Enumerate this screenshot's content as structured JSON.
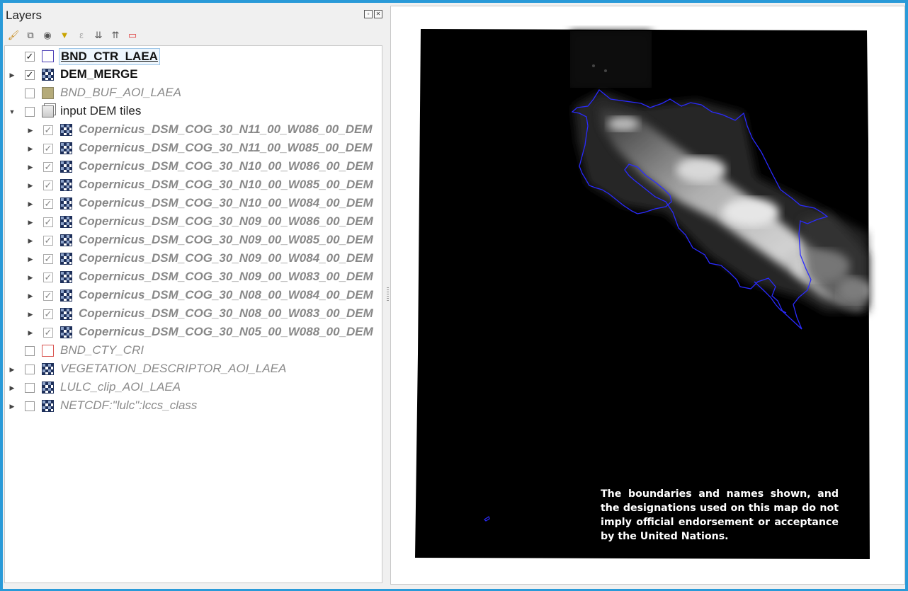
{
  "panel": {
    "title": "Layers",
    "float_btn": "▫",
    "close_btn": "✕"
  },
  "toolbar": [
    {
      "name": "style-brush-icon",
      "glyph": "🖌"
    },
    {
      "name": "add-group-icon",
      "glyph": "⧉"
    },
    {
      "name": "eye-icon",
      "glyph": "◉"
    },
    {
      "name": "filter-icon",
      "glyph": "▼"
    },
    {
      "name": "filter-expression-icon",
      "glyph": "ε"
    },
    {
      "name": "expand-all-icon",
      "glyph": "⇊"
    },
    {
      "name": "collapse-all-icon",
      "glyph": "⇈"
    },
    {
      "name": "remove-layer-icon",
      "glyph": "▭"
    }
  ],
  "layers": [
    {
      "label": "BND_CTR_LAEA",
      "checked": true,
      "style": "bold underline",
      "icon": "vector-outline",
      "icon_color": "#4b3fb5",
      "expander": "",
      "indent": 0,
      "selected": true
    },
    {
      "label": "DEM_MERGE",
      "checked": true,
      "style": "bold",
      "icon": "raster",
      "expander": "▶",
      "indent": 0
    },
    {
      "label": "BND_BUF_AOI_LAEA",
      "checked": false,
      "style": "italic",
      "icon": "vector-fill",
      "icon_color": "#b5ab7a",
      "expander": "",
      "indent": 0
    },
    {
      "label": "input DEM tiles",
      "checked": false,
      "style": "normal",
      "icon": "group",
      "expander": "▼",
      "indent": 0
    },
    {
      "label": "Copernicus_DSM_COG_30_N11_00_W086_00_DEM",
      "checked": true,
      "style": "sub",
      "icon": "raster",
      "expander": "▶",
      "indent": 1
    },
    {
      "label": "Copernicus_DSM_COG_30_N11_00_W085_00_DEM",
      "checked": true,
      "style": "sub",
      "icon": "raster",
      "expander": "▶",
      "indent": 1
    },
    {
      "label": "Copernicus_DSM_COG_30_N10_00_W086_00_DEM",
      "checked": true,
      "style": "sub",
      "icon": "raster",
      "expander": "▶",
      "indent": 1
    },
    {
      "label": "Copernicus_DSM_COG_30_N10_00_W085_00_DEM",
      "checked": true,
      "style": "sub",
      "icon": "raster",
      "expander": "▶",
      "indent": 1
    },
    {
      "label": "Copernicus_DSM_COG_30_N10_00_W084_00_DEM",
      "checked": true,
      "style": "sub",
      "icon": "raster",
      "expander": "▶",
      "indent": 1
    },
    {
      "label": "Copernicus_DSM_COG_30_N09_00_W086_00_DEM",
      "checked": true,
      "style": "sub",
      "icon": "raster",
      "expander": "▶",
      "indent": 1
    },
    {
      "label": "Copernicus_DSM_COG_30_N09_00_W085_00_DEM",
      "checked": true,
      "style": "sub",
      "icon": "raster",
      "expander": "▶",
      "indent": 1
    },
    {
      "label": "Copernicus_DSM_COG_30_N09_00_W084_00_DEM",
      "checked": true,
      "style": "sub",
      "icon": "raster",
      "expander": "▶",
      "indent": 1
    },
    {
      "label": "Copernicus_DSM_COG_30_N09_00_W083_00_DEM",
      "checked": true,
      "style": "sub",
      "icon": "raster",
      "expander": "▶",
      "indent": 1
    },
    {
      "label": "Copernicus_DSM_COG_30_N08_00_W084_00_DEM",
      "checked": true,
      "style": "sub",
      "icon": "raster",
      "expander": "▶",
      "indent": 1
    },
    {
      "label": "Copernicus_DSM_COG_30_N08_00_W083_00_DEM",
      "checked": true,
      "style": "sub",
      "icon": "raster",
      "expander": "▶",
      "indent": 1
    },
    {
      "label": "Copernicus_DSM_COG_30_N05_00_W088_00_DEM",
      "checked": true,
      "style": "sub",
      "icon": "raster",
      "expander": "▶",
      "indent": 1
    },
    {
      "label": "BND_CTY_CRI",
      "checked": false,
      "style": "italic",
      "icon": "vector-outline",
      "icon_color": "#d9534f",
      "expander": "",
      "indent": 0
    },
    {
      "label": "VEGETATION_DESCRIPTOR_AOI_LAEA",
      "checked": false,
      "style": "italic",
      "icon": "raster",
      "expander": "▶",
      "indent": 0
    },
    {
      "label": "LULC_clip_AOI_LAEA",
      "checked": false,
      "style": "italic",
      "icon": "raster",
      "expander": "▶",
      "indent": 0
    },
    {
      "label": "NETCDF:\"lulc\":lccs_class",
      "checked": false,
      "style": "italic",
      "icon": "raster",
      "expander": "▶",
      "indent": 0
    }
  ],
  "map": {
    "background": "#000000",
    "boundary_color": "#2a2aff",
    "disclaimer": "The boundaries and names shown, and the designations used on this map do not imply official endorsement or acceptance by the United Nations."
  }
}
